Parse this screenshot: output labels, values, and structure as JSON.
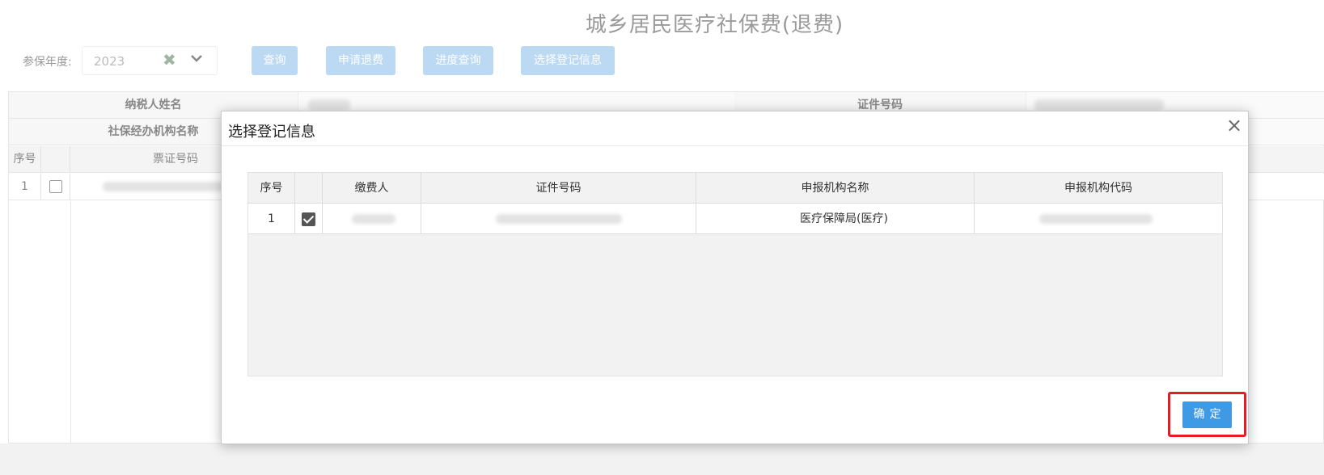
{
  "page": {
    "title": "城乡居民医疗社保费(退费)"
  },
  "filters": {
    "year_label": "参保年度:",
    "year_value": "2023",
    "clear_icon": "clear-x-icon",
    "dropdown_icon": "chevron-down-icon"
  },
  "toolbar": {
    "query_label": "查询",
    "apply_refund_label": "申请退费",
    "progress_query_label": "进度查询",
    "select_registration_label": "选择登记信息"
  },
  "background_table": {
    "taxpayer_name_label": "纳税人姓名",
    "id_number_label": "证件号码",
    "agency_name_label": "社保经办机构名称",
    "columns": [
      "序号",
      "",
      "票证号码"
    ],
    "rows": [
      {
        "index": "1"
      }
    ]
  },
  "modal": {
    "title": "选择登记信息",
    "close_icon": "close-icon",
    "columns": [
      "序号",
      "",
      "缴费人",
      "证件号码",
      "申报机构名称",
      "申报机构代码"
    ],
    "rows": [
      {
        "index": "1",
        "checked": true,
        "payer": "",
        "id_number": "",
        "agency_name": "医疗保障局(医疗)",
        "agency_code": ""
      }
    ],
    "confirm_label": "确定"
  },
  "colors": {
    "primary": "#3f9ae6",
    "primary_light": "#bcd9f4",
    "highlight": "#e51c23"
  }
}
